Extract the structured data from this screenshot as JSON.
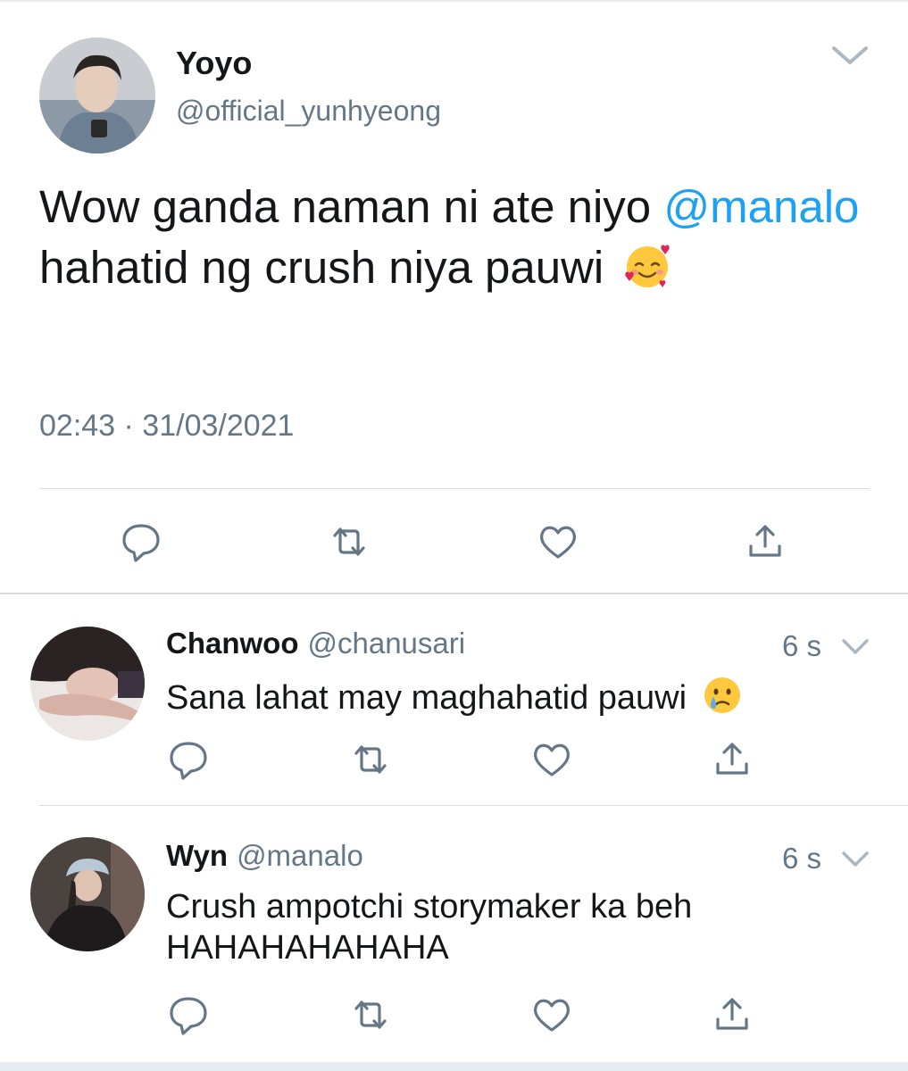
{
  "main_tweet": {
    "display_name": "Yoyo",
    "handle": "@official_yunhyeong",
    "text_part1": "Wow ganda naman ni ate niyo ",
    "mention": "@manalo",
    "text_part2": " hahatid ng crush niya pauwi",
    "emoji": "smiling-face-with-hearts",
    "timestamp": "02:43 · 31/03/2021",
    "actions": [
      "reply-icon",
      "retweet-icon",
      "like-icon",
      "share-icon"
    ]
  },
  "replies": [
    {
      "display_name": "Chanwoo",
      "handle": "@chanusari",
      "time": "6 s",
      "text": "Sana lahat may maghahatid pauwi",
      "emoji": "crying-face"
    },
    {
      "display_name": "Wyn",
      "handle": "@manalo",
      "time": "6 s",
      "text": "Crush ampotchi storymaker ka beh HAHAHAHAHAHA"
    }
  ],
  "colors": {
    "text": "#14171a",
    "secondary": "#657786",
    "link": "#1da1f2",
    "icon": "#657786",
    "divider": "#d8dee3"
  }
}
